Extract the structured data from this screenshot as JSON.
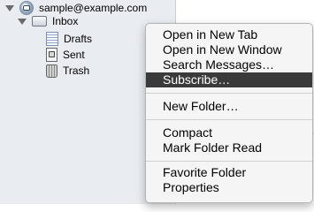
{
  "folder_tree": {
    "account": {
      "label": "sample@example.com",
      "icon": "account-icon"
    },
    "inbox": {
      "label": "Inbox",
      "icon": "inbox-icon"
    },
    "children": [
      {
        "label": "Drafts",
        "icon": "drafts-icon"
      },
      {
        "label": "Sent",
        "icon": "sent-icon"
      },
      {
        "label": "Trash",
        "icon": "trash-icon"
      }
    ]
  },
  "context_menu": {
    "highlighted_item": "Subscribe…",
    "groups": [
      [
        "Open in New Tab",
        "Open in New Window",
        "Search Messages…",
        "Subscribe…"
      ],
      [
        "New Folder…"
      ],
      [
        "Compact",
        "Mark Folder Read"
      ],
      [
        "Favorite Folder",
        "Properties"
      ]
    ]
  },
  "colors": {
    "sidebar_bg": "#e9ecf0",
    "menu_bg": "#f5f5f5",
    "highlight_bg": "#3a3a3a",
    "highlight_text": "#ffffff"
  }
}
